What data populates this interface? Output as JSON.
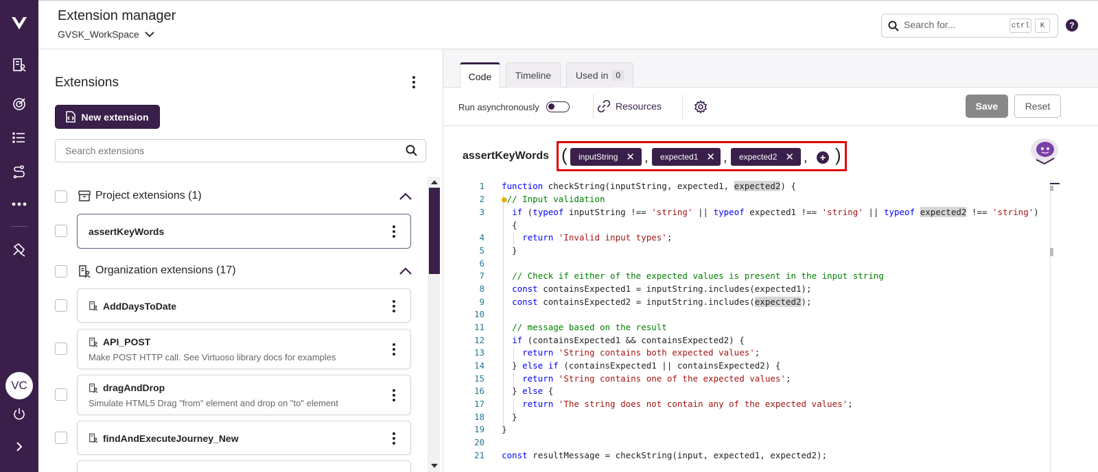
{
  "header": {
    "title": "Extension manager",
    "workspace": "GVSK_WorkSpace",
    "search_placeholder": "Search for...",
    "shortcut_ctrl": "ctrl",
    "shortcut_key": "K",
    "help_label": "?"
  },
  "rail": {
    "avatar_initials": "VC",
    "icons": [
      "logo-icon",
      "projects-icon",
      "goals-icon",
      "list-icon",
      "journeys-icon",
      "more-icon",
      "extensions-icon",
      "power-icon",
      "expand-icon"
    ]
  },
  "left_panel": {
    "title": "Extensions",
    "new_button": "New extension",
    "search_placeholder": "Search extensions",
    "groups": [
      {
        "label": "Project extensions (1)"
      },
      {
        "label": "Organization extensions (17)"
      }
    ],
    "project_items": [
      {
        "name": "assertKeyWords"
      }
    ],
    "org_items": [
      {
        "name": "AddDaysToDate",
        "description": ""
      },
      {
        "name": "API_POST",
        "description": "Make POST HTTP call. See Virtuoso library docs for examples"
      },
      {
        "name": "dragAndDrop",
        "description": "Simulate HTML5 Drag \"from\" element and drop on \"to\" element"
      },
      {
        "name": "findAndExecuteJourney_New",
        "description": ""
      }
    ]
  },
  "right_panel": {
    "tabs": [
      {
        "label": "Code"
      },
      {
        "label": "Timeline"
      },
      {
        "label": "Used in",
        "badge": "0"
      }
    ],
    "run_async_label": "Run asynchronously",
    "run_async": false,
    "resources_label": "Resources",
    "save_label": "Save",
    "reset_label": "Reset",
    "function_name": "assertKeyWords",
    "open_paren": "(",
    "close_paren": ")",
    "comma": ",",
    "params": [
      "inputString",
      "expected1",
      "expected2"
    ],
    "code_line_numbers": [
      "1",
      "2",
      "3",
      "4",
      "5",
      "6",
      "7",
      "8",
      "9",
      "10",
      "11",
      "12",
      "13",
      "14",
      "15",
      "16",
      "17",
      "18",
      "19",
      "20",
      "21"
    ]
  },
  "colors": {
    "brand": "#3a1f4b",
    "highlight_border": "#e00000",
    "save_disabled": "#888888"
  }
}
